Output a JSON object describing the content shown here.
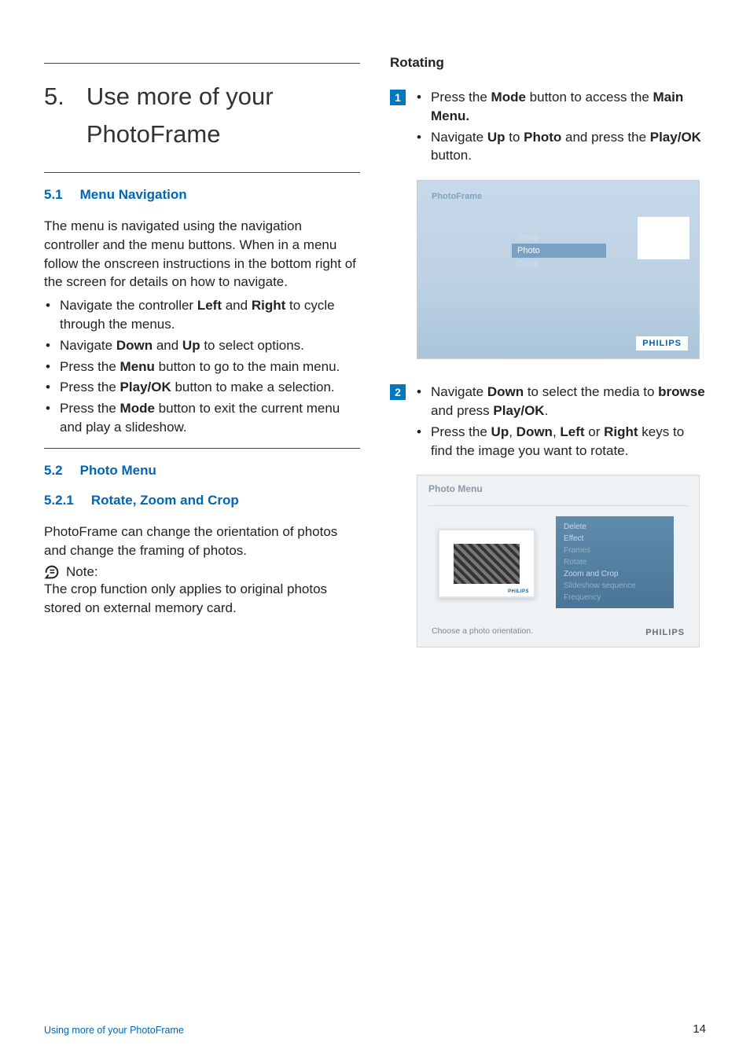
{
  "chapter": {
    "num": "5.",
    "title_line1": "Use more of your",
    "title_line2": "PhotoFrame"
  },
  "s51": {
    "num": "5.1",
    "title": "Menu Navigation",
    "intro": "The menu is navigated using the navigation controller and the menu buttons. When in a menu follow the onscreen instructions in the bottom right of the screen for details on how to navigate.",
    "bullets": {
      "b1a": "Navigate the controller ",
      "b1b": "Left",
      "b1c": " and ",
      "b1d": "Right",
      "b1e": " to cycle through the menus.",
      "b2a": "Navigate ",
      "b2b": "Down",
      "b2c": " and ",
      "b2d": "Up",
      "b2e": " to select options.",
      "b3a": "Press the ",
      "b3b": "Menu",
      "b3c": " button to go to the main menu.",
      "b4a": "Press the ",
      "b4b": "Play/OK",
      "b4c": " button to make a selection.",
      "b5a": "Press the ",
      "b5b": "Mode",
      "b5c": " button to exit the current menu and play a slideshow."
    }
  },
  "s52": {
    "num": "5.2",
    "title": "Photo Menu"
  },
  "s521": {
    "num": "5.2.1",
    "title": "Rotate, Zoom and Crop",
    "p1": "PhotoFrame can change the orientation of photos and change the framing of photos.",
    "note_label": "Note:",
    "note_body": "The crop function only applies to original photos stored on external memory card."
  },
  "rotating": {
    "heading": "Rotating",
    "step1": {
      "num": "1",
      "b1a": "Press the ",
      "b1b": "Mode",
      "b1c": " button to access the ",
      "b1d": "Main Menu.",
      "b2a": "Navigate ",
      "b2b": "Up",
      "b2c": " to ",
      "b2d": "Photo",
      "b2e": " and press the ",
      "b2f": "Play/OK",
      "b2g": " button."
    },
    "ss1": {
      "tab": "PhotoFrame",
      "m1": "Setup",
      "m2": "Photo",
      "m3": "Clock",
      "logo": "PHILIPS"
    },
    "step2": {
      "num": "2",
      "b1a": "Navigate ",
      "b1b": "Down",
      "b1c": " to select the media to ",
      "b1d": "browse",
      "b1e": " and press ",
      "b1f": "Play/OK",
      "b1g": ".",
      "b2a": "Press the ",
      "b2b": "Up",
      "b2c": ", ",
      "b2d": "Down",
      "b2e": ", ",
      "b2f": "Left",
      "b2g": " or ",
      "b2h": "Right",
      "b2i": " keys to find the image you want to rotate."
    },
    "ss2": {
      "title": "Photo Menu",
      "m1": "Delete",
      "m2": "Effect",
      "m3": "Frames",
      "m4": "Rotate",
      "m5": "Zoom and Crop",
      "m6": "Slideshow sequence",
      "m7": "Frequency",
      "hint": "Choose a photo orientation.",
      "logo": "PHILIPS",
      "thumb_brand": "PHILIPS"
    }
  },
  "footer": {
    "left": "Using more of your PhotoFrame",
    "right": "14"
  }
}
